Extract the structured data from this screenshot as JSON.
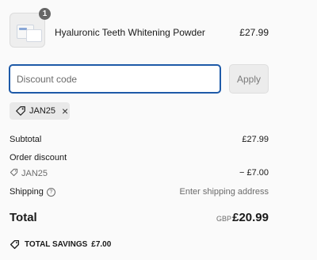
{
  "line_item": {
    "quantity": "1",
    "name": "Hyaluronic Teeth Whitening Powder",
    "price": "£27.99"
  },
  "discount": {
    "placeholder": "Discount code",
    "apply_label": "Apply",
    "applied_code": "JAN25"
  },
  "summary": {
    "subtotal_label": "Subtotal",
    "subtotal_value": "£27.99",
    "order_discount_label": "Order discount",
    "order_discount_code": "JAN25",
    "order_discount_value": "− £7.00",
    "shipping_label": "Shipping",
    "shipping_value": "Enter shipping address",
    "total_label": "Total",
    "currency": "GBP",
    "total_value": "£20.99",
    "savings_label": "TOTAL SAVINGS",
    "savings_value": "£7.00"
  },
  "colors": {
    "input_focus_border": "#1e5aa8",
    "badge": "#666666",
    "muted_text": "#6b6b6b"
  }
}
